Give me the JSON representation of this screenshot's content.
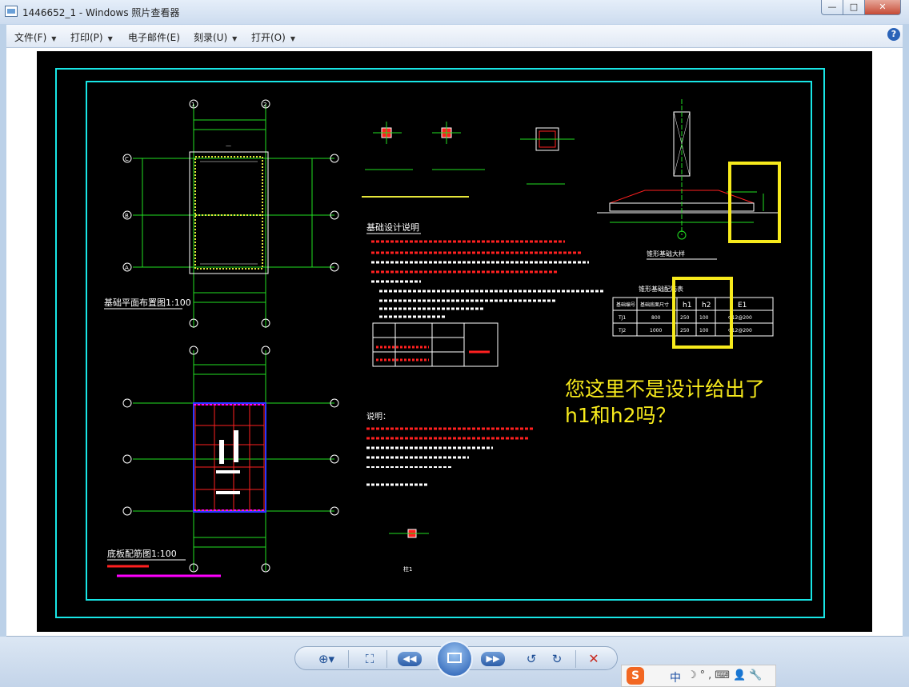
{
  "window": {
    "title": "1446652_1 - Windows 照片查看器",
    "min_symbol": "—",
    "max_symbol": "□",
    "close_symbol": "✕"
  },
  "menu": {
    "items": [
      {
        "label": "文件(F)"
      },
      {
        "label": "打印(P)"
      },
      {
        "label": "电子邮件(E)"
      },
      {
        "label": "刻录(U)"
      },
      {
        "label": "打开(O)"
      }
    ],
    "help_symbol": "?"
  },
  "drawing": {
    "plan_title_1": "基础平面布置图1:100",
    "plan_title_2": "底板配筋图1:100",
    "notes_title": "基础设计说明",
    "notes2_title": "说明：",
    "detail_title": "锥形基础大样",
    "table_title": "锥形基础配筋表",
    "table_headers": [
      "基础编号",
      "基础底面尺寸",
      "h1",
      "h2",
      "E1"
    ],
    "table_rows": [
      [
        "TJ1",
        "800",
        "250",
        "100",
        "Φ12@200"
      ],
      [
        "TJ2",
        "1000",
        "250",
        "100",
        "Φ12@200"
      ]
    ],
    "axis_labels_top": [
      "1",
      "2"
    ],
    "axis_labels_side": [
      "C",
      "B",
      "A"
    ],
    "small_detail_label": "柱1"
  },
  "comment": {
    "line1": "您这里不是设计给出了",
    "line2": "h1和h2吗？"
  },
  "toolbar": {
    "zoom_symbol": "⊕▾",
    "fit_symbol": "⛶",
    "prev_symbol": "◀◀",
    "next_symbol": "▶▶",
    "rotate_left_symbol": "↺",
    "rotate_right_symbol": "↻",
    "delete_symbol": "✕"
  },
  "ime": {
    "logo": "S",
    "mode": "中",
    "icons": "☽°,⌨👤🔧"
  },
  "colors": {
    "cad_background": "#000000",
    "frame_cyan": "#18e6e6",
    "highlight_yellow": "#f7ea1c",
    "cad_green": "#22e022",
    "cad_red": "#ff2020",
    "cad_magenta": "#ff00ff"
  }
}
